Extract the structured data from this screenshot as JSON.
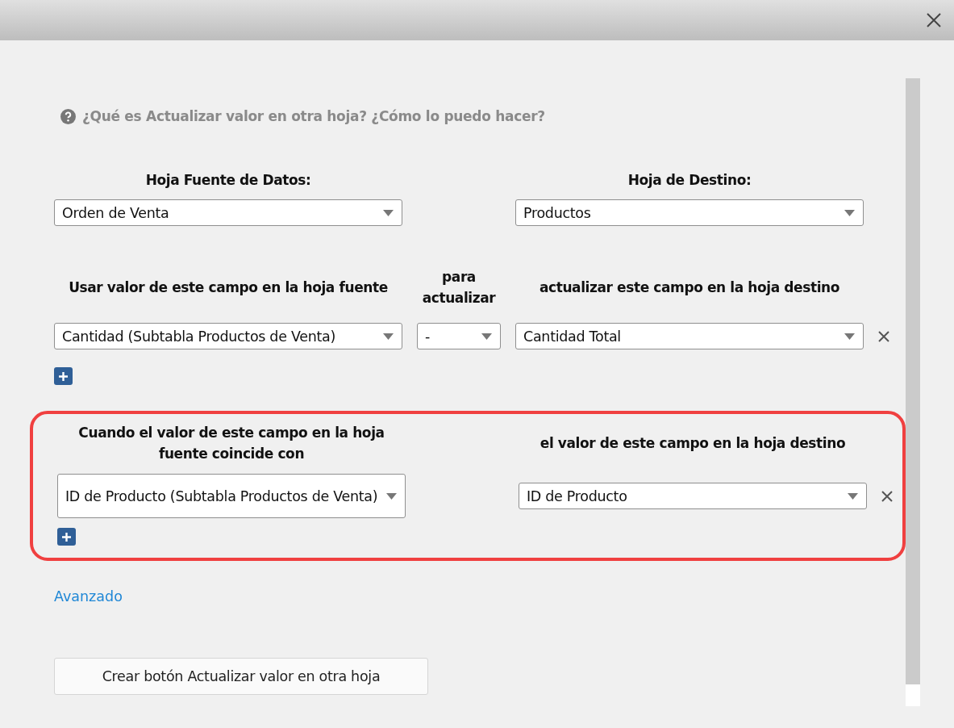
{
  "help_text": "¿Qué es Actualizar valor en otra hoja? ¿Cómo lo puedo hacer?",
  "source_sheet": {
    "label": "Hoja Fuente de Datos:",
    "value": "Orden de Venta"
  },
  "target_sheet": {
    "label": "Hoja de Destino:",
    "value": "Productos"
  },
  "update_mapping": {
    "headers": [
      "Usar valor de este campo en la hoja fuente",
      "para actualizar",
      "actualizar este campo en la hoja destino"
    ],
    "rows": [
      {
        "source": "Cantidad (Subtabla Productos de Venta)",
        "operator": "-",
        "target": "Cantidad Total"
      }
    ]
  },
  "match_condition": {
    "highlighted": true,
    "headers": [
      "Cuando el valor de este campo en la hoja fuente coincide con",
      "el valor de este campo en la hoja destino"
    ],
    "rows": [
      {
        "source": "ID de Producto (Subtabla Productos de Venta)",
        "target": "ID de Producto"
      }
    ]
  },
  "advanced_link": "Avanzado",
  "create_button": "Crear botón Actualizar valor en otra hoja"
}
